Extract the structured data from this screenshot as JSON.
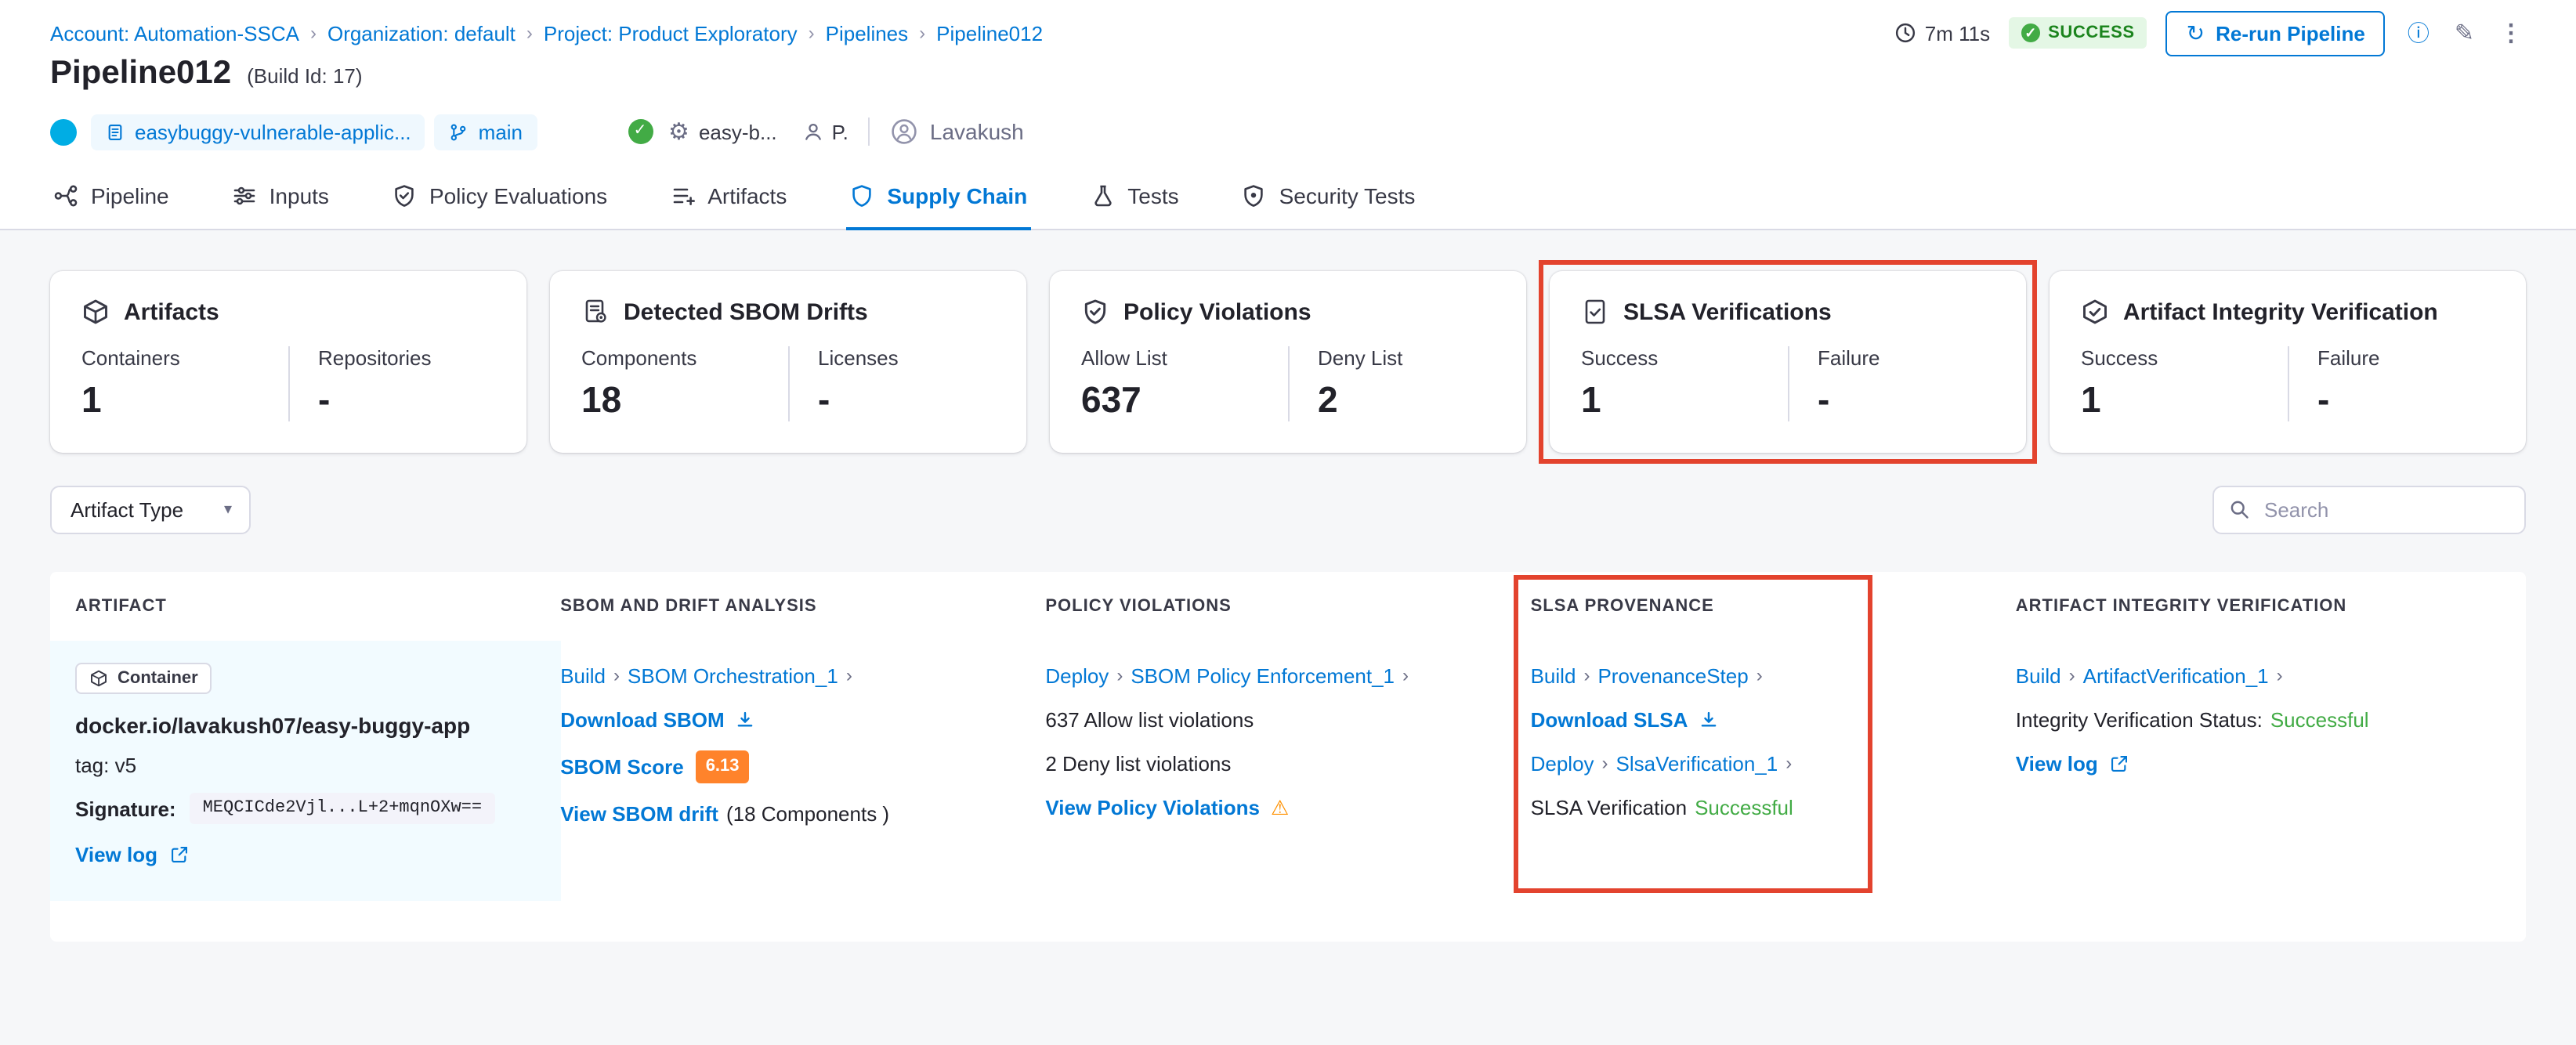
{
  "colors": {
    "accent": "#0278d5",
    "textDark": "#22222a",
    "textMid": "#383946",
    "textGray": "#6b6d85",
    "border": "#d9dae5",
    "pageBg": "#f6f7f9",
    "chipBg": "#eff8fe",
    "success": "#1b841d",
    "successBg": "#e4f7e5",
    "successFill": "#42ab45",
    "annotation": "#e3432e",
    "warning": "#ff9100",
    "scoreBg": "#ff832b",
    "artifactCellBg": "#f2fbff"
  },
  "breadcrumb": {
    "items": [
      "Account: Automation-SSCA",
      "Organization: default",
      "Project: Product Exploratory",
      "Pipelines",
      "Pipeline012"
    ]
  },
  "topbar": {
    "duration": "7m 11s",
    "status_label": "SUCCESS",
    "rerun_label": "Re-run Pipeline"
  },
  "header": {
    "title": "Pipeline012",
    "build_id": "(Build Id: 17)",
    "repo_name": "easybuggy-vulnerable-applic...",
    "branch_name": "main",
    "execution_label": "easy-b...",
    "user_initial": "P.",
    "user_name": "Lavakush"
  },
  "tabs": [
    {
      "label": "Pipeline"
    },
    {
      "label": "Inputs"
    },
    {
      "label": "Policy Evaluations"
    },
    {
      "label": "Artifacts"
    },
    {
      "label": "Supply Chain"
    },
    {
      "label": "Tests"
    },
    {
      "label": "Security Tests"
    }
  ],
  "summary": {
    "cards": [
      {
        "title": "Artifacts",
        "metrics": [
          {
            "label": "Containers",
            "value": "1"
          },
          {
            "label": "Repositories",
            "value": "-"
          }
        ]
      },
      {
        "title": "Detected SBOM Drifts",
        "metrics": [
          {
            "label": "Components",
            "value": "18"
          },
          {
            "label": "Licenses",
            "value": "-"
          }
        ]
      },
      {
        "title": "Policy Violations",
        "metrics": [
          {
            "label": "Allow List",
            "value": "637"
          },
          {
            "label": "Deny List",
            "value": "2"
          }
        ]
      },
      {
        "title": "SLSA Verifications",
        "metrics": [
          {
            "label": "Success",
            "value": "1"
          },
          {
            "label": "Failure",
            "value": "-"
          }
        ]
      },
      {
        "title": "Artifact Integrity Verification",
        "metrics": [
          {
            "label": "Success",
            "value": "1"
          },
          {
            "label": "Failure",
            "value": "-"
          }
        ]
      }
    ]
  },
  "filters": {
    "artifact_type_label": "Artifact Type",
    "search_placeholder": "Search"
  },
  "table": {
    "columns": [
      "ARTIFACT",
      "SBOM AND DRIFT ANALYSIS",
      "POLICY VIOLATIONS",
      "SLSA PROVENANCE",
      "ARTIFACT INTEGRITY VERIFICATION"
    ],
    "row": {
      "artifact": {
        "type_badge": "Container",
        "name": "docker.io/lavakush07/easy-buggy-app",
        "tag": "tag: v5",
        "signature_label": "Signature:",
        "signature_value": "MEQCICde2Vjl...L+2+mqnOXw==",
        "view_log_label": "View log"
      },
      "sbom": {
        "stage": "Build",
        "step": "SBOM Orchestration_1",
        "download_label": "Download SBOM",
        "score_label": "SBOM Score",
        "score_value": "6.13",
        "drift_label": "View SBOM drift",
        "drift_suffix": "(18 Components )"
      },
      "policy": {
        "stage": "Deploy",
        "step": "SBOM Policy Enforcement_1",
        "allow_text": "637 Allow list violations",
        "deny_text": "2 Deny list violations",
        "view_label": "View Policy Violations"
      },
      "slsa": {
        "stage1": "Build",
        "step1": "ProvenanceStep",
        "download_label": "Download SLSA",
        "stage2": "Deploy",
        "step2": "SlsaVerification_1",
        "status_prefix": "SLSA Verification",
        "status_value": "Successful"
      },
      "integrity": {
        "stage": "Build",
        "step": "ArtifactVerification_1",
        "status_prefix": "Integrity Verification Status:",
        "status_value": "Successful",
        "view_log_label": "View log"
      }
    }
  }
}
